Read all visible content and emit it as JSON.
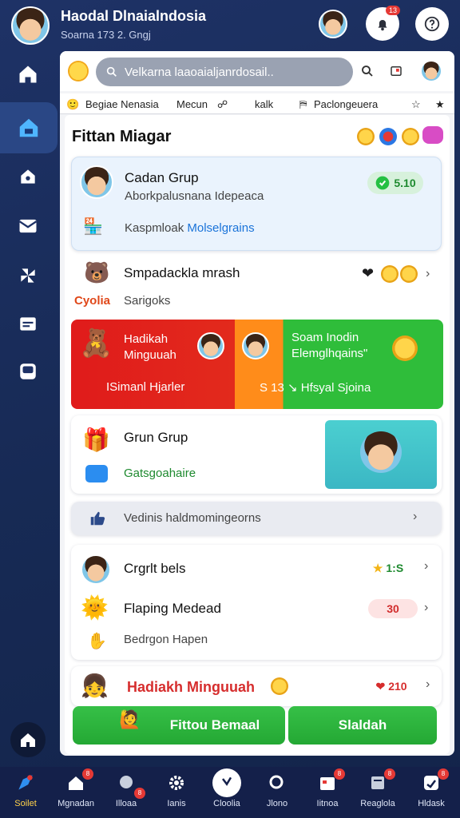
{
  "header": {
    "title": "Haodal Dlnaialndosia",
    "subtitle": "Soarna 173 2. Gngj",
    "notification_count": "13"
  },
  "search": {
    "placeholder": "Velkarna laaoaialjanrdosail.."
  },
  "tabs": [
    "Begiae Nenasia",
    "Mecun",
    "kalk",
    "Paclongeuera"
  ],
  "section": {
    "title": "Fittan Miagar"
  },
  "group_card": {
    "title": "Cadan Grup",
    "subtitle": "Aborkpalusnana Idepeaca",
    "pill": "5.10",
    "link_prefix": "Kaspmloak",
    "link_accent": "Molselgrains"
  },
  "simple_row": {
    "title": "Smpadackla mrash",
    "brand": "Cyolia",
    "subtitle": "Sarigoks"
  },
  "promo": {
    "left_title_1": "Hadikah",
    "left_title_2": "Minguuah",
    "left_action": "ISimanl Hjarler",
    "right_title_1": "Soam Inodin",
    "right_title_2": "Elemglhqains\"",
    "right_action": "S 13 ↘ Hfsyal Sjoina"
  },
  "grun_card": {
    "title": "Grun Grup",
    "link": "Gatsgoahaire"
  },
  "info_bar": {
    "text": "Vedinis haldmomingeorns"
  },
  "list": {
    "row1_title": "Crgrlt bels",
    "row1_pill": "1:S",
    "row2_title": "Flaping Medead",
    "row2_pill": "30",
    "row3_title": "Bedrgon Hapen"
  },
  "footer_row": {
    "title": "Hadiakh Minguuah",
    "pill": "210"
  },
  "buttons": {
    "primary": "Fittou Bemaal",
    "secondary": "Slaldah"
  },
  "bottom_nav": [
    {
      "label": "Soilet",
      "badge": ""
    },
    {
      "label": "Mgnadan",
      "badge": "8"
    },
    {
      "label": "Illoaa",
      "badge": "8"
    },
    {
      "label": "Ianis",
      "badge": ""
    },
    {
      "label": "Cloolia",
      "badge": ""
    },
    {
      "label": "Jlono",
      "badge": ""
    },
    {
      "label": "Iitnoa",
      "badge": "8"
    },
    {
      "label": "Reaglola",
      "badge": "8"
    },
    {
      "label": "Hldask",
      "badge": "8"
    }
  ],
  "colors": {
    "accent_green": "#2fbd3a",
    "accent_red": "#e01b1b",
    "accent_orange": "#ff8c1a",
    "nav_active": "#ffd24a",
    "link_blue": "#1a73d9"
  }
}
